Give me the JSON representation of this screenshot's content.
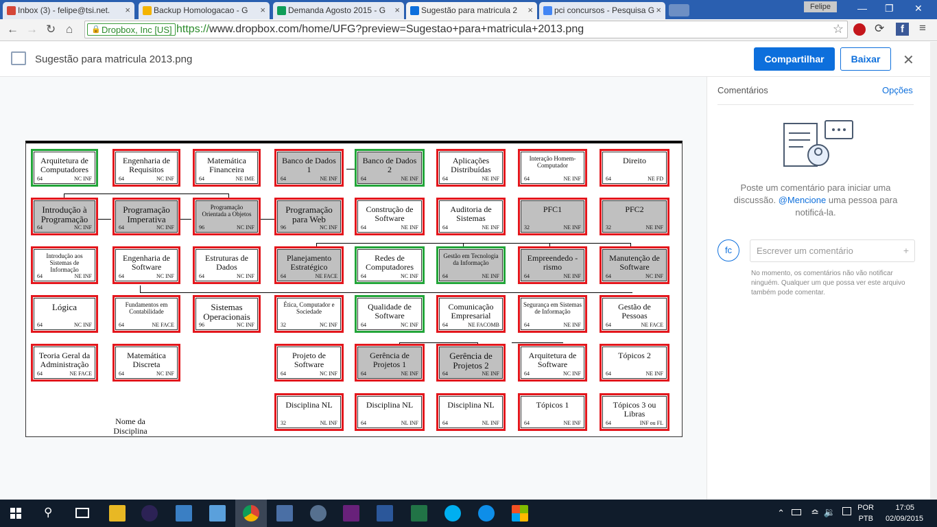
{
  "tabs": [
    {
      "label": "Inbox (3) - felipe@tsi.net.",
      "icon": "gmail-icon",
      "color": "#d44638"
    },
    {
      "label": "Backup Homologacao - G",
      "icon": "drive-icon",
      "color": "#f4b400"
    },
    {
      "label": "Demanda Agosto 2015 - G",
      "icon": "sheets-icon",
      "color": "#0f9d58"
    },
    {
      "label": "Sugestão para matricula 2",
      "icon": "dropbox-icon",
      "color": "#0d6fdc"
    },
    {
      "label": "pci concursos - Pesquisa G",
      "icon": "google-icon",
      "color": "#4285f4"
    }
  ],
  "window": {
    "user": "Felipe"
  },
  "omnibox": {
    "secure_label": "Dropbox, Inc [US]",
    "scheme": "https://",
    "url": "www.dropbox.com/home/UFG?preview=Sugestao+para+matricula+2013.png"
  },
  "viewer": {
    "filename": "Sugestão para matricula 2013.png",
    "share": "Compartilhar",
    "download": "Baixar"
  },
  "comments": {
    "title": "Comentários",
    "options": "Opções",
    "empty_1": "Poste um comentário para iniciar uma discussão.",
    "mention": "@Mencione",
    "empty_2": "uma pessoa para notificá-la.",
    "avatar": "fc",
    "placeholder": "Escrever um comentário",
    "note": "No momento, os comentários não vão notificar ninguém. Qualquer um que possa ver este arquivo também pode comentar."
  },
  "diagram": {
    "legend": "Nome da Disciplina",
    "boxes": [
      {
        "t": "Arquitetura de Computadores",
        "l": "64",
        "r": "NC   INF",
        "c": "g",
        "gray": false
      },
      {
        "t": "Engenharia de Requisitos",
        "l": "64",
        "r": "NC   INF",
        "c": "r",
        "gray": false
      },
      {
        "t": "Matemática Financeira",
        "l": "64",
        "r": "NE   IME",
        "c": "r",
        "gray": false
      },
      {
        "t": "Banco de Dados 1",
        "l": "64",
        "r": "NE  INF",
        "c": "r",
        "gray": true
      },
      {
        "t": "Banco de Dados 2",
        "l": "64",
        "r": "NE  INF",
        "c": "g",
        "gray": true
      },
      {
        "t": "Aplicações Distribuídas",
        "l": "64",
        "r": "NE  INF",
        "c": "r",
        "gray": false
      },
      {
        "t": "Interação Homem-Computador",
        "l": "64",
        "r": "NE  INF",
        "c": "r",
        "gray": false,
        "sm": true
      },
      {
        "t": "Direito",
        "l": "64",
        "r": "NE FD",
        "c": "r",
        "gray": false
      },
      {
        "t": "Introdução à Programação",
        "l": "64",
        "r": "NC  INF",
        "c": "r",
        "gray": true,
        "big": true
      },
      {
        "t": "Programação Imperativa",
        "l": "64",
        "r": "NC  INF",
        "c": "r",
        "gray": true,
        "big": true
      },
      {
        "t": "Programação Orientada a Objetos",
        "l": "96",
        "r": "NC  INF",
        "c": "r",
        "gray": true,
        "sm": true
      },
      {
        "t": "Programação para Web",
        "l": "96",
        "r": "NC  INF",
        "c": "r",
        "gray": true,
        "big": true
      },
      {
        "t": "Construção de Software",
        "l": "64",
        "r": "NE  INF",
        "c": "r",
        "gray": false
      },
      {
        "t": "Auditoria de Sistemas",
        "l": "64",
        "r": "NE  INF",
        "c": "r",
        "gray": false
      },
      {
        "t": "PFC1",
        "l": "32",
        "r": "NE  INF",
        "c": "r",
        "gray": true
      },
      {
        "t": "PFC2",
        "l": "32",
        "r": "NE  INF",
        "c": "r",
        "gray": true
      },
      {
        "t": "Introdução aos Sistemas de Informação",
        "l": "64",
        "r": "NE  INF",
        "c": "r",
        "gray": false,
        "sm": true
      },
      {
        "t": "Engenharia de Software",
        "l": "64",
        "r": "NC  INF",
        "c": "r",
        "gray": false
      },
      {
        "t": "Estruturas de Dados",
        "l": "64",
        "r": "NC  INF",
        "c": "r",
        "gray": false
      },
      {
        "t": "Planejamento Estratégico",
        "l": "64",
        "r": "NE  FACE",
        "c": "r",
        "gray": true
      },
      {
        "t": "Redes de Computadores",
        "l": "64",
        "r": "NC  INF",
        "c": "g",
        "gray": false
      },
      {
        "t": "Gestão em Tecnologia da Informação",
        "l": "64",
        "r": "NE  INF",
        "c": "g",
        "gray": true,
        "sm": true
      },
      {
        "t": "Empreendedo -rismo",
        "l": "64",
        "r": "NE  INF",
        "c": "r",
        "gray": true
      },
      {
        "t": "Manutenção de Software",
        "l": "64",
        "r": "NC  INF",
        "c": "r",
        "gray": true
      },
      {
        "t": "Lógica",
        "l": "64",
        "r": "NC  INF",
        "c": "r",
        "gray": false,
        "big": true
      },
      {
        "t": "Fundamentos em Contabilidade",
        "l": "64",
        "r": "NE  FACE",
        "c": "r",
        "gray": false,
        "sm": true
      },
      {
        "t": "Sistemas Operacionais",
        "l": "96",
        "r": "NC  INF",
        "c": "r",
        "gray": false,
        "big": true
      },
      {
        "t": "Ética, Computador e Sociedade",
        "l": "32",
        "r": "NC INF",
        "c": "r",
        "gray": false,
        "sm": true
      },
      {
        "t": "Qualidade de Software",
        "l": "64",
        "r": "NC  INF",
        "c": "g",
        "gray": false
      },
      {
        "t": "Comunicação Empresarial",
        "l": "64",
        "r": "NE  FACOMB",
        "c": "r",
        "gray": false
      },
      {
        "t": "Segurança em Sistemas de Informação",
        "l": "64",
        "r": "NE  INF",
        "c": "r",
        "gray": false,
        "sm": true
      },
      {
        "t": "Gestão de Pessoas",
        "l": "64",
        "r": "NE  FACE",
        "c": "r",
        "gray": false
      },
      {
        "t": "Teoria Geral da Administração",
        "l": "64",
        "r": "NE   FACE",
        "c": "r",
        "gray": false
      },
      {
        "t": "Matemática Discreta",
        "l": "64",
        "r": "NC  INF",
        "c": "r",
        "gray": false
      },
      {
        "t": "Projeto de Software",
        "l": "64",
        "r": "NC  INF",
        "c": "r",
        "gray": false
      },
      {
        "t": "Gerência de Projetos 1",
        "l": "64",
        "r": "NE  INF",
        "c": "r",
        "gray": true
      },
      {
        "t": "Gerência de Projetos 2",
        "l": "64",
        "r": "NE  INF",
        "c": "r",
        "gray": true,
        "big": true
      },
      {
        "t": "Arquitetura de Software",
        "l": "64",
        "r": "NC  INF",
        "c": "r",
        "gray": false
      },
      {
        "t": "Tópicos 2",
        "l": "64",
        "r": "NE  INF",
        "c": "r",
        "gray": false
      },
      {
        "t": "Disciplina NL",
        "l": "32",
        "r": "NL  INF",
        "c": "r",
        "gray": false
      },
      {
        "t": "Disciplina NL",
        "l": "64",
        "r": "NL  INF",
        "c": "r",
        "gray": false
      },
      {
        "t": "Disciplina NL",
        "l": "64",
        "r": "NL  INF",
        "c": "r",
        "gray": false
      },
      {
        "t": "Tópicos 1",
        "l": "64",
        "r": "NE  INF",
        "c": "r",
        "gray": false
      },
      {
        "t": "Tópicos 3 ou Libras",
        "l": "64",
        "r": "INF ou FL",
        "c": "r",
        "gray": false
      }
    ]
  },
  "taskbar": {
    "lang1": "POR",
    "lang2": "PTB",
    "time": "17:05",
    "date": "02/09/2015"
  }
}
